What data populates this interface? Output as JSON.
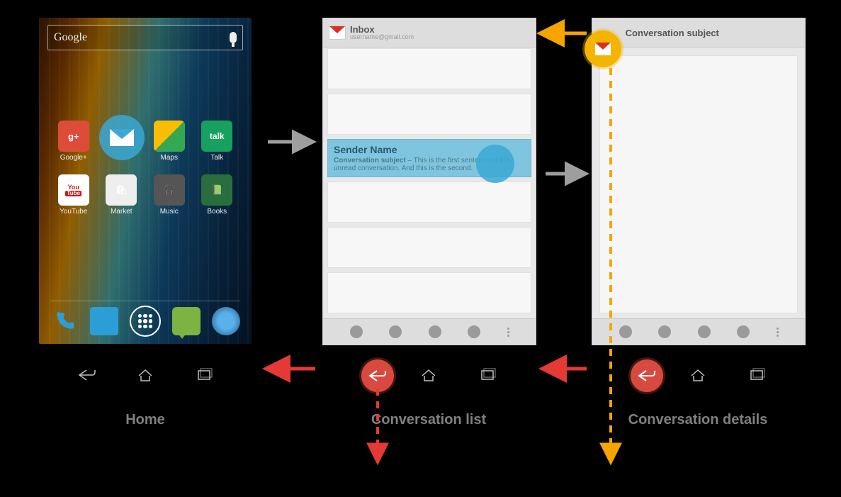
{
  "captions": {
    "home": "Home",
    "list": "Conversation list",
    "detail": "Conversation details"
  },
  "home": {
    "search_label": "Google",
    "apps": {
      "googleplus": "Google+",
      "gmail": "Gmail",
      "maps": "Maps",
      "talk": "Talk",
      "youtube": "YouTube",
      "market": "Market",
      "music": "Music",
      "books": "Books"
    },
    "talk_tile": "talk",
    "googleplus_tile": "g+",
    "youtube_tile": "You"
  },
  "list": {
    "title": "Inbox",
    "subtitle": "username@gmail.com",
    "sender": "Sender Name",
    "subject": "Conversation subject",
    "preview": "This is the first sentence of this unread conversation. And this is the second."
  },
  "detail": {
    "title": "Conversation subject"
  },
  "colors": {
    "highlight_back": "#d84a3f",
    "highlight_up": "#f5b400",
    "touch": "#3aa8d4",
    "arrow_gray": "#9e9e9e",
    "arrow_red": "#e53935",
    "arrow_amber": "#f5a400"
  }
}
